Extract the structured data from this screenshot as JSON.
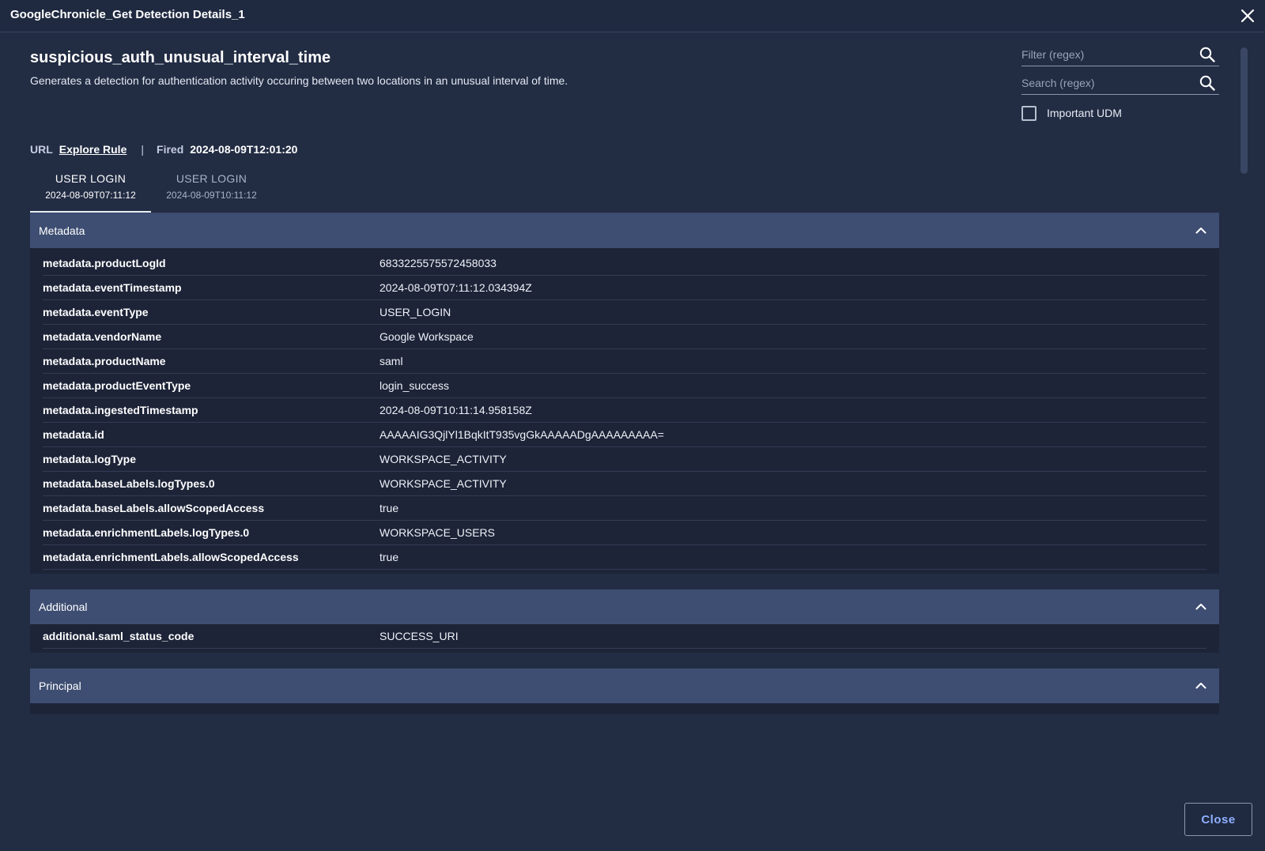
{
  "window": {
    "title": "GoogleChronicle_Get Detection Details_1"
  },
  "rule": {
    "name": "suspicious_auth_unusual_interval_time",
    "description": "Generates a detection for authentication activity occuring between two locations in an unusual interval of time."
  },
  "filter": {
    "placeholder": "Filter (regex)"
  },
  "search": {
    "placeholder": "Search (regex)"
  },
  "important_udm": {
    "label": "Important UDM",
    "checked": false
  },
  "meta": {
    "url_label": "URL",
    "url_link": "Explore Rule",
    "separator": "|",
    "fired_label": "Fired",
    "fired_value": "2024-08-09T12:01:20"
  },
  "tabs": [
    {
      "label": "USER LOGIN",
      "date": "2024-08-09T07:11:12",
      "active": true
    },
    {
      "label": "USER LOGIN",
      "date": "2024-08-09T10:11:12",
      "active": false
    }
  ],
  "sections": {
    "metadata": {
      "title": "Metadata",
      "rows": [
        {
          "key": "metadata.productLogId",
          "value": "6833225575572458033"
        },
        {
          "key": "metadata.eventTimestamp",
          "value": "2024-08-09T07:11:12.034394Z"
        },
        {
          "key": "metadata.eventType",
          "value": "USER_LOGIN"
        },
        {
          "key": "metadata.vendorName",
          "value": "Google Workspace"
        },
        {
          "key": "metadata.productName",
          "value": "saml"
        },
        {
          "key": "metadata.productEventType",
          "value": "login_success"
        },
        {
          "key": "metadata.ingestedTimestamp",
          "value": "2024-08-09T10:11:14.958158Z"
        },
        {
          "key": "metadata.id",
          "value": "AAAAAIG3QjlYl1BqkItT935vgGkAAAAADgAAAAAAAAA="
        },
        {
          "key": "metadata.logType",
          "value": "WORKSPACE_ACTIVITY"
        },
        {
          "key": "metadata.baseLabels.logTypes.0",
          "value": "WORKSPACE_ACTIVITY"
        },
        {
          "key": "metadata.baseLabels.allowScopedAccess",
          "value": "true"
        },
        {
          "key": "metadata.enrichmentLabels.logTypes.0",
          "value": "WORKSPACE_USERS"
        },
        {
          "key": "metadata.enrichmentLabels.allowScopedAccess",
          "value": "true"
        }
      ]
    },
    "additional": {
      "title": "Additional",
      "rows": [
        {
          "key": "additional.saml_status_code",
          "value": "SUCCESS_URI"
        }
      ]
    },
    "principal": {
      "title": "Principal"
    }
  },
  "footer": {
    "close_label": "Close"
  },
  "icons": {
    "window_close": "close-icon",
    "search": "search-icon",
    "collapse": "chevron-up-icon"
  },
  "colors": {
    "background": "#222c43",
    "section_header": "#3e4e72",
    "section_body": "#1d2438",
    "accent": "#8fb0ff"
  }
}
